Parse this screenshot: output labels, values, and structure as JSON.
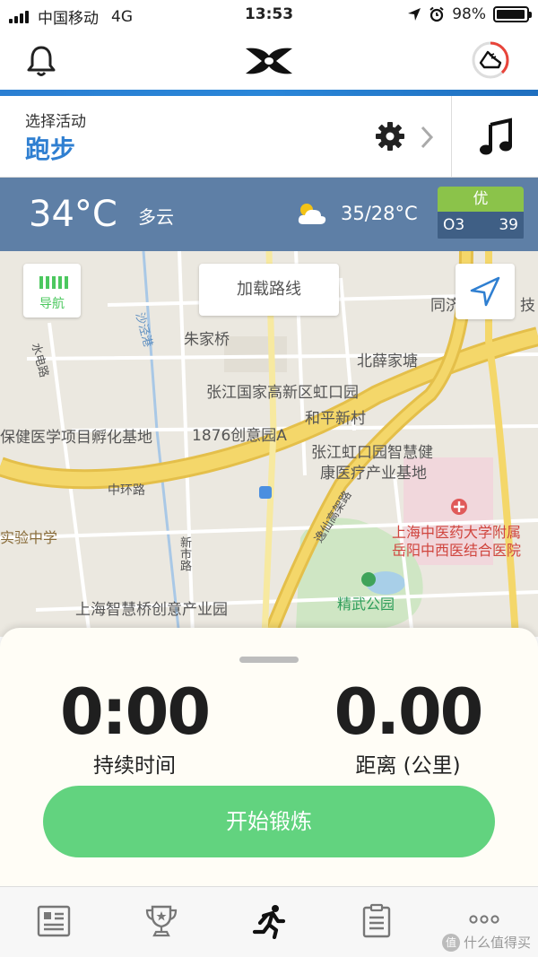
{
  "status_bar": {
    "carrier": "中国移动",
    "network": "4G",
    "time": "13:53",
    "battery": "98%",
    "battery_level": 0.98
  },
  "activity": {
    "select_label": "选择活动",
    "current": "跑步"
  },
  "weather": {
    "temperature": "34°C",
    "condition": "多云",
    "range": "35/28°C",
    "aqi_level": "优",
    "aqi_pollutant": "O3",
    "aqi_value": "39"
  },
  "map": {
    "nav_button": "导航",
    "load_route_button": "加载路线",
    "labels": {
      "zhujiaqiao": "朱家桥",
      "beixuejiatang": "北薛家塘",
      "zhangjiang_park": "张江国家高新区虹口园",
      "heping": "和平新村",
      "incubator": "保健医学项目孵化基地",
      "chuangyi": "1876创意园A",
      "smart_health_1": "张江虹口园智慧健",
      "smart_health_2": "康医疗产业基地",
      "ring_road": "中环路",
      "hospital_1": "上海中医药大学附属",
      "hospital_2": "岳阳中西医结合医院",
      "school": "实验中学",
      "xinshi_road": "新市路",
      "jingwu_park": "精武公园",
      "zhihuiqiao": "上海智慧桥创意产业园",
      "shui_dian_road": "水电路",
      "shajing": "沙泾港",
      "yixian": "逸仙高架路",
      "tongji": "同济",
      "ji": "技"
    }
  },
  "panel": {
    "duration_value": "0:00",
    "duration_label": "持续时间",
    "distance_value": "0.00",
    "distance_label": "距离 (公里)",
    "start_button": "开始锻炼"
  },
  "tabs": [
    "feed",
    "challenges",
    "record",
    "plans",
    "more"
  ],
  "watermark": "什么值得买",
  "colors": {
    "accent_blue": "#2f7fd1",
    "weather_bg": "#5e7fa6",
    "start_green": "#62d37f",
    "aqi_green": "#8bc34a"
  }
}
